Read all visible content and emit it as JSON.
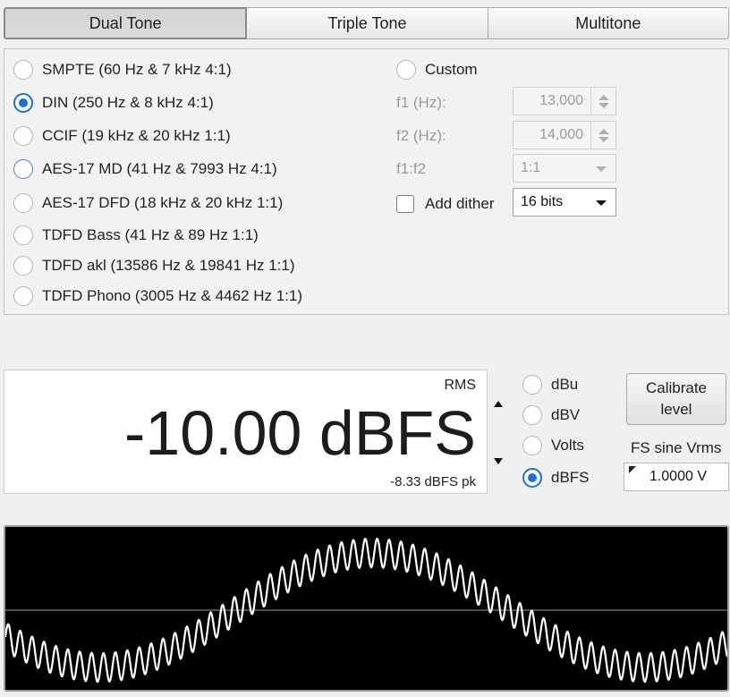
{
  "tabs": [
    {
      "label": "Dual Tone",
      "selected": true
    },
    {
      "label": "Triple Tone",
      "selected": false
    },
    {
      "label": "Multitone",
      "selected": false
    }
  ],
  "presets": [
    {
      "label": "SMPTE (60 Hz & 7 kHz 4:1)",
      "checked": false
    },
    {
      "label": "DIN (250 Hz & 8 kHz 4:1)",
      "checked": true
    },
    {
      "label": "CCIF (19 kHz & 20 kHz 1:1)",
      "checked": false
    },
    {
      "label": "AES-17 MD (41 Hz & 7993 Hz 4:1)",
      "checked": false
    },
    {
      "label": "AES-17 DFD (18 kHz & 20 kHz 1:1)",
      "checked": false
    },
    {
      "label": "TDFD Bass (41 Hz & 89 Hz 1:1)",
      "checked": false
    },
    {
      "label": "TDFD akl (13586 Hz & 19841 Hz 1:1)",
      "checked": false
    },
    {
      "label": "TDFD Phono (3005 Hz & 4462 Hz 1:1)",
      "checked": false
    }
  ],
  "custom": {
    "label": "Custom",
    "f1_label": "f1 (Hz):",
    "f1_value": "13,000",
    "f2_label": "f2 (Hz):",
    "f2_value": "14,000",
    "ratio_label": "f1:f2",
    "ratio_value": "1:1",
    "dither_label": "Add dither",
    "dither_value": "16 bits"
  },
  "level": {
    "rms_label": "RMS",
    "main_value": "-10.00 dBFS",
    "peak_value": "-8.33 dBFS pk"
  },
  "units": [
    {
      "label": "dBu",
      "checked": false
    },
    {
      "label": "dBV",
      "checked": false
    },
    {
      "label": "Volts",
      "checked": false
    },
    {
      "label": "dBFS",
      "checked": true
    }
  ],
  "calibrate_label": "Calibrate\nlevel",
  "fs_sine_label": "FS sine Vrms",
  "fs_sine_value": "1.0000 V",
  "colors": {
    "accent": "#1e6fd9",
    "scope_background": "#000000",
    "scope_trace": "#ffffff"
  },
  "icons": {
    "radio": "radio-button",
    "spinner": "spinner-arrows",
    "dropdown": "chevron-down-icon",
    "stepper": "level-stepper-arrows"
  }
}
